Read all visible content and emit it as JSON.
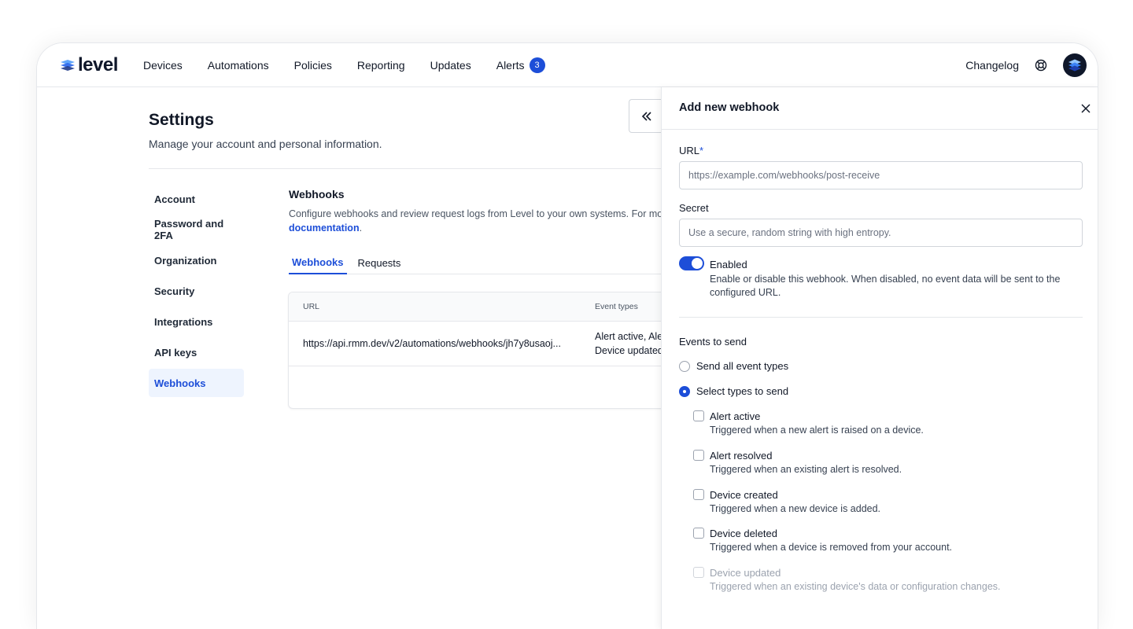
{
  "app": {
    "logo_text": "level"
  },
  "nav": {
    "items": [
      "Devices",
      "Automations",
      "Policies",
      "Reporting",
      "Updates",
      "Alerts"
    ],
    "alerts_badge": "3",
    "changelog": "Changelog"
  },
  "settings": {
    "title": "Settings",
    "subtitle": "Manage your account and personal information.",
    "side_items": [
      "Account",
      "Password and 2FA",
      "Organization",
      "Security",
      "Integrations",
      "API keys",
      "Webhooks"
    ],
    "active_item": "Webhooks"
  },
  "webhooks": {
    "title": "Webhooks",
    "description": "Configure webhooks and review request logs from Level to your own systems. For more",
    "doc_link": "documentation",
    "doc_period": ".",
    "tabs": [
      "Webhooks",
      "Requests"
    ],
    "active_tab": "Webhooks",
    "table": {
      "headers": [
        "URL",
        "Event types"
      ],
      "rows": [
        {
          "url": "https://api.rmm.dev/v2/automations/webhooks/jh7y8usaoj...",
          "events_line1": "Alert active, Ale",
          "events_line2": "Device updated"
        }
      ]
    }
  },
  "panel": {
    "title": "Add new webhook",
    "url_label": "URL",
    "required_mark": "*",
    "url_placeholder": "https://example.com/webhooks/post-receive",
    "secret_label": "Secret",
    "secret_placeholder": "Use a secure, random string with high entropy.",
    "enabled_label": "Enabled",
    "enabled_on": true,
    "enabled_desc": "Enable or disable this webhook. When disabled, no event data will be sent to the configured URL.",
    "events_title": "Events to send",
    "radio_all": "Send all event types",
    "radio_select": "Select types to send",
    "selected_radio": "select",
    "event_types": [
      {
        "title": "Alert active",
        "desc": "Triggered when a new alert is raised on a device."
      },
      {
        "title": "Alert resolved",
        "desc": "Triggered when an existing alert is resolved."
      },
      {
        "title": "Device created",
        "desc": "Triggered when a new device is added."
      },
      {
        "title": "Device deleted",
        "desc": "Triggered when a device is removed from your account."
      },
      {
        "title": "Device updated",
        "desc": "Triggered when an existing device's data or configuration changes."
      }
    ]
  },
  "colors": {
    "accent": "#1d4ed8",
    "active_bg": "#eef4fe",
    "border": "#e5e7eb"
  }
}
